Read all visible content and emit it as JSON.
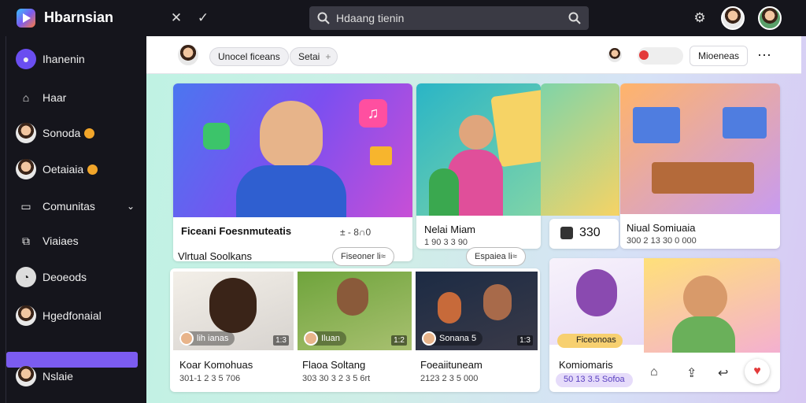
{
  "app": {
    "title": "Hbarnsian"
  },
  "search": {
    "placeholder": "Hdaang tienin"
  },
  "sidebar": {
    "items": [
      {
        "label": "Ihanenin"
      },
      {
        "label": "Haar"
      },
      {
        "label": "Sonoda"
      },
      {
        "label": "Oetaiaia"
      },
      {
        "label": "Comunitas"
      },
      {
        "label": "Viaiaes"
      },
      {
        "label": "Deoeods"
      },
      {
        "label": "Hgedfonaial"
      },
      {
        "label": "Nslaie"
      }
    ]
  },
  "toolbar": {
    "chip1": "Unocel ficeans",
    "chip2": "Setai",
    "right_button": "Mioeneas"
  },
  "hero": {
    "title": "Ficeani Foesnmuteatis",
    "meta": "± - 8∩0",
    "card2_title": "Nelai Miam",
    "card2_sub": "1 90 3 3 90",
    "stat": "330",
    "card3_title": "Niual Somiuaia",
    "card3_sub": "300 2 13 30 0 000"
  },
  "section": {
    "title": "Vlrtual Soolkans",
    "pill1": "Fiseoner li≈",
    "pill2": "Espaiea li≈"
  },
  "videos": [
    {
      "badge": "lih ianas",
      "dur": "1:3",
      "title": "Koar Komohuas",
      "sub": "301-1 2 3 5 706"
    },
    {
      "badge": "Iluan",
      "dur": "1:2",
      "title": "Flaoa Soltang",
      "sub": "303 30 3 2 3 5 6rt"
    },
    {
      "badge": "Sonana 5",
      "dur": "1:3",
      "title": "Foeaiituneam",
      "sub": "2123 2 3 5 000"
    }
  ],
  "side_card": {
    "badge": "Ficeonoas",
    "title": "Komiomaris",
    "tag": "50 13 3.5 Sofoa"
  },
  "colors": {
    "accent": "#7b5cf0",
    "coin": "#f1a52a",
    "heart": "#e33a3a"
  }
}
